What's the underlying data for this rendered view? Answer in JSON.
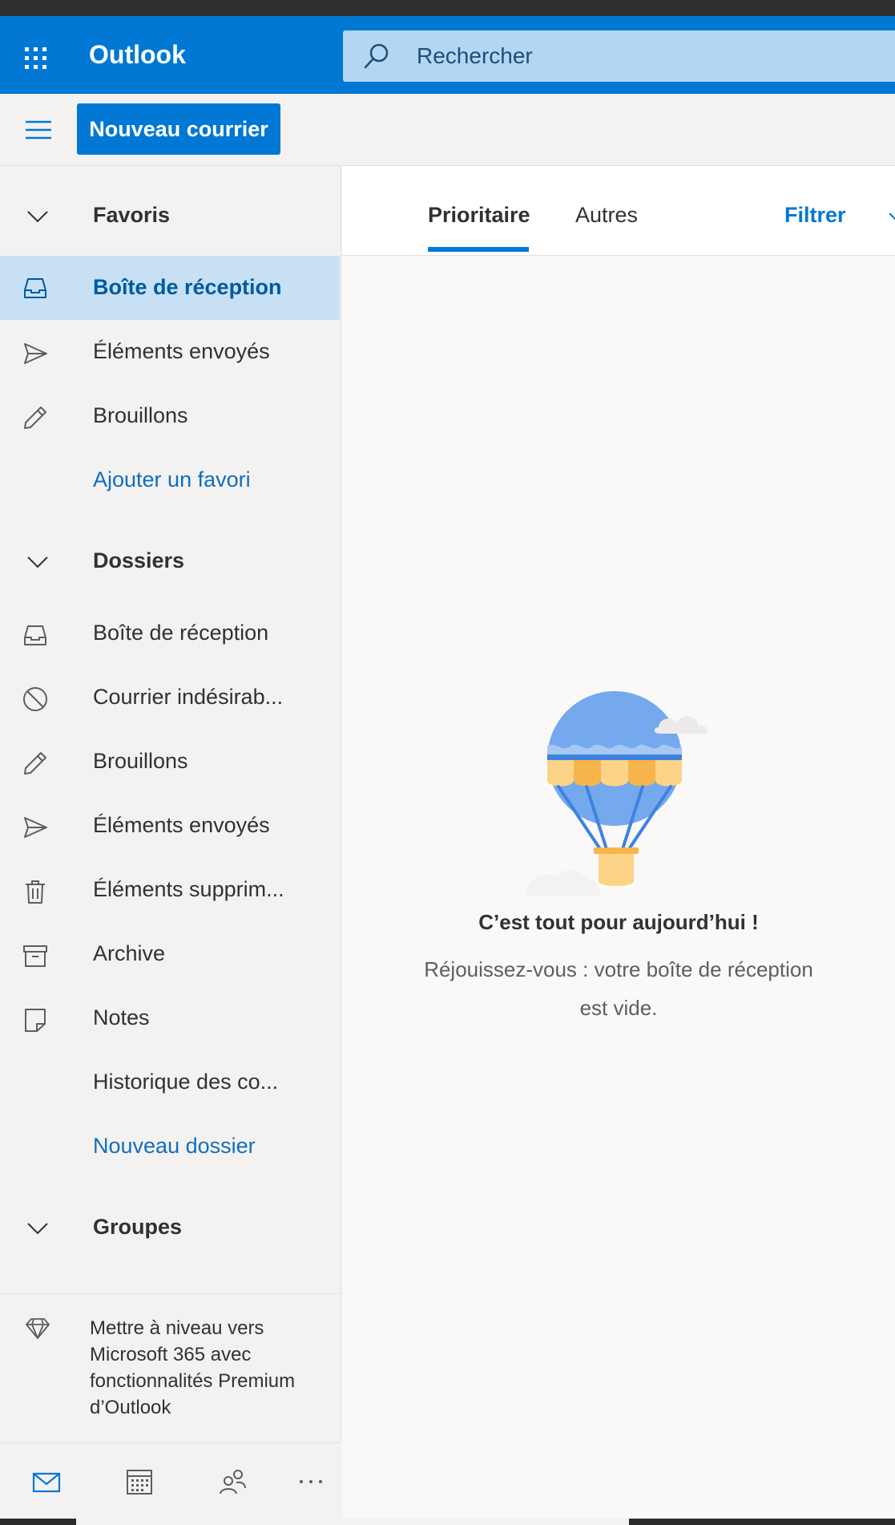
{
  "app": {
    "title": "Outlook"
  },
  "search": {
    "placeholder": "Rechercher"
  },
  "toolbar": {
    "new_mail_label": "Nouveau courrier"
  },
  "sidebar": {
    "favorites_header": "Favoris",
    "favorites": [
      {
        "label": "Boîte de réception",
        "icon": "inbox-icon",
        "selected": true
      },
      {
        "label": "Éléments envoyés",
        "icon": "send-icon"
      },
      {
        "label": "Brouillons",
        "icon": "pencil-icon"
      },
      {
        "label": "Ajouter un favori",
        "icon": ""
      }
    ],
    "folders_header": "Dossiers",
    "folders": [
      {
        "label": "Boîte de réception",
        "icon": "inbox-icon"
      },
      {
        "label": "Courrier indésirab...",
        "icon": "blocked-icon"
      },
      {
        "label": "Brouillons",
        "icon": "pencil-icon"
      },
      {
        "label": "Éléments envoyés",
        "icon": "send-icon"
      },
      {
        "label": "Éléments supprim...",
        "icon": "trash-icon"
      },
      {
        "label": "Archive",
        "icon": "archive-icon"
      },
      {
        "label": "Notes",
        "icon": "note-icon"
      },
      {
        "label": "Historique des co...",
        "icon": ""
      },
      {
        "label": "Nouveau dossier",
        "icon": ""
      }
    ],
    "groups_header": "Groupes",
    "upgrade_text": "Mettre à niveau vers Microsoft 365 avec fonctionnalités Premium d’Outlook"
  },
  "bottom_nav": [
    "mail-icon",
    "calendar-icon",
    "people-icon",
    "more-icon"
  ],
  "tabs": [
    {
      "label": "Prioritaire",
      "active": true
    },
    {
      "label": "Autres",
      "active": false
    }
  ],
  "filter_label": "Filtrer",
  "empty_state": {
    "title": "C’est tout pour aujourd’hui !",
    "subtitle": "Réjouissez-vous : votre boîte de réception est vide."
  },
  "colors": {
    "accent": "#0078d4",
    "selected_bg": "#c7e0f4",
    "link": "#106ebe"
  }
}
